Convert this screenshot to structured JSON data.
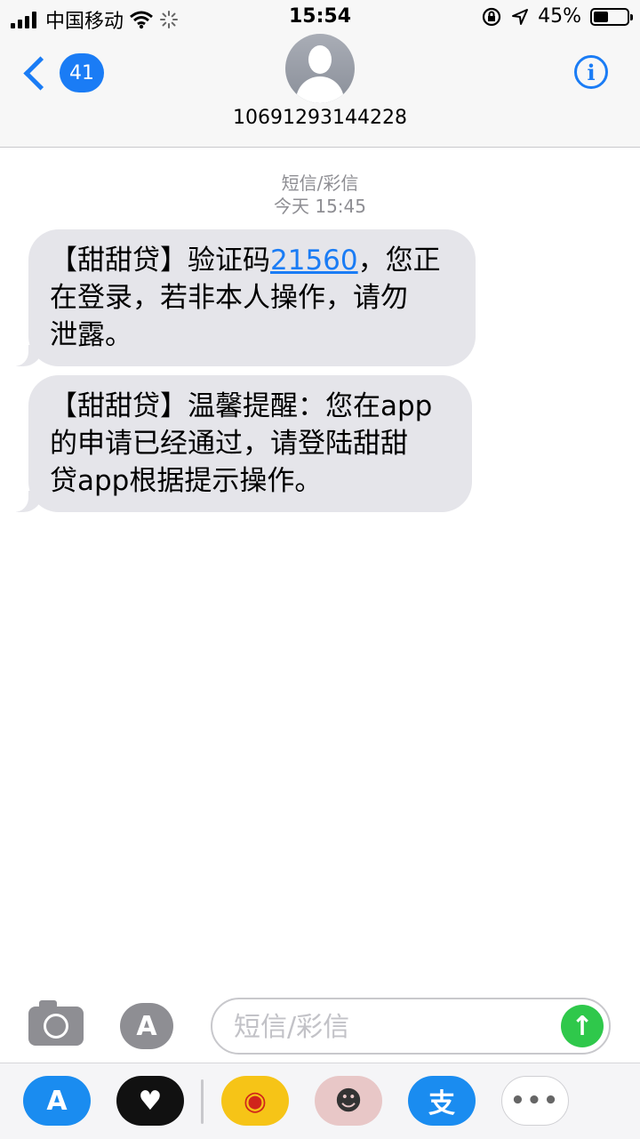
{
  "status_bar": {
    "carrier": "中国移动",
    "time": "15:54",
    "battery_percent": "45%",
    "battery_level": 0.45,
    "icons": [
      "signal-bars-icon",
      "wifi-icon",
      "loading-spinner-icon",
      "orientation-lock-icon",
      "location-arrow-icon",
      "battery-icon"
    ]
  },
  "header": {
    "back_count": "41",
    "contact_name": "10691293144228",
    "info_label": "i"
  },
  "thread": {
    "service_label": "短信/彩信",
    "timestamp": "今天 15:45"
  },
  "messages": [
    {
      "lines": [
        "【甜甜贷】验证码",
        "21560",
        "，您正",
        "在登录，若非本人操作，请勿",
        "泄露。"
      ],
      "code": "21560"
    },
    {
      "lines": [
        "【甜甜贷】温馨提醒：您在app",
        "的申请已经通过，请登陆甜甜",
        "贷app根据提示操作。"
      ]
    }
  ],
  "input_bar": {
    "placeholder": "短信/彩信",
    "appstore_label": "A",
    "send_label": "↑"
  },
  "app_drawer": {
    "apps": [
      {
        "name": "App Store",
        "icon": "appstore-icon",
        "glyph": "A",
        "color": "#1a8cf0"
      },
      {
        "name": "Digital Touch",
        "icon": "heart-icon",
        "glyph": "♥",
        "color": "#111111"
      },
      {
        "name": "Weibo",
        "icon": "weibo-icon",
        "glyph": "◉",
        "color": "#f6c417"
      },
      {
        "name": "Stickers",
        "icon": "sticker-icon",
        "glyph": "☻",
        "color": "#e8c7c7"
      },
      {
        "name": "Alipay",
        "icon": "alipay-icon",
        "glyph": "支",
        "color": "#1a8cf0"
      },
      {
        "name": "More",
        "icon": "more-icon",
        "glyph": "•••",
        "color": "#ffffff"
      }
    ]
  },
  "colors": {
    "accent": "#1a7cf5",
    "bubble": "#e5e5ea",
    "send": "#2fc84b",
    "meta_text": "#8e8e93"
  }
}
